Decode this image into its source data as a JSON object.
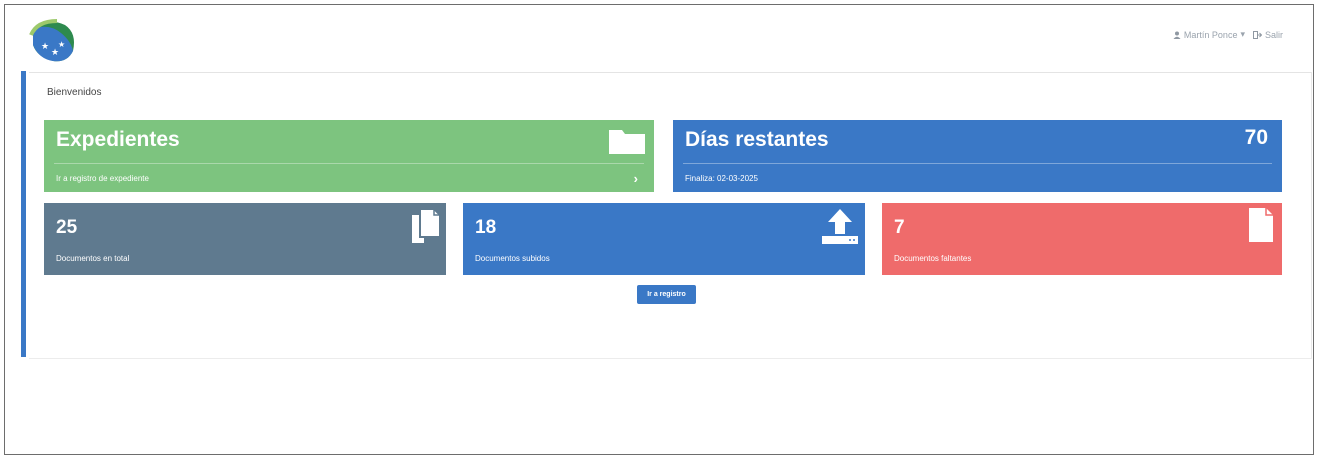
{
  "header": {
    "user_label": "Martín Ponce",
    "user_caret": "▾",
    "logout_label": "Salir"
  },
  "welcome": "Bienvenidos",
  "cards": {
    "expedientes": {
      "title": "Expedientes",
      "footer": "Ir a registro de expediente",
      "chevron": "›",
      "color": "#7dc47f"
    },
    "dias": {
      "title": "Días restantes",
      "value": "70",
      "footer": "Finaliza: 02-03-2025",
      "color": "#3a78c6"
    },
    "total": {
      "value": "25",
      "label": "Documentos en total",
      "color": "#5f7a8f"
    },
    "subidos": {
      "value": "18",
      "label": "Documentos subidos",
      "color": "#3a78c6"
    },
    "faltantes": {
      "value": "7",
      "label": "Documentos faltantes",
      "color": "#ef6b6b"
    }
  },
  "button_label": "Ir a registro",
  "icons": {
    "user": "user-icon",
    "logout": "sign-out-icon",
    "folder": "folder-icon",
    "copy": "copy-files-icon",
    "upload": "upload-icon",
    "file": "file-icon"
  }
}
